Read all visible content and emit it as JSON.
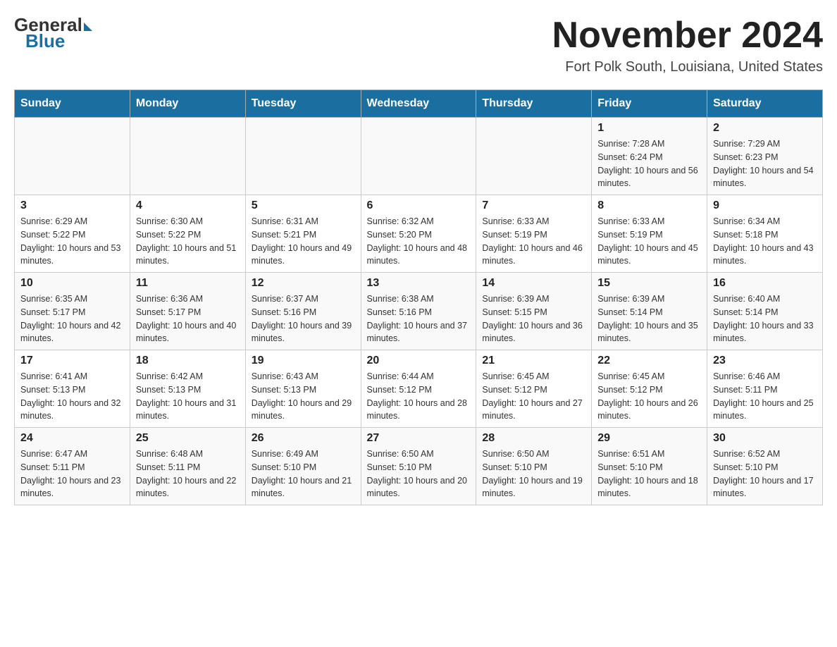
{
  "logo": {
    "general": "General",
    "blue": "Blue"
  },
  "title": "November 2024",
  "location": "Fort Polk South, Louisiana, United States",
  "days_of_week": [
    "Sunday",
    "Monday",
    "Tuesday",
    "Wednesday",
    "Thursday",
    "Friday",
    "Saturday"
  ],
  "weeks": [
    {
      "days": [
        {
          "number": "",
          "info": ""
        },
        {
          "number": "",
          "info": ""
        },
        {
          "number": "",
          "info": ""
        },
        {
          "number": "",
          "info": ""
        },
        {
          "number": "",
          "info": ""
        },
        {
          "number": "1",
          "info": "Sunrise: 7:28 AM\nSunset: 6:24 PM\nDaylight: 10 hours and 56 minutes."
        },
        {
          "number": "2",
          "info": "Sunrise: 7:29 AM\nSunset: 6:23 PM\nDaylight: 10 hours and 54 minutes."
        }
      ]
    },
    {
      "days": [
        {
          "number": "3",
          "info": "Sunrise: 6:29 AM\nSunset: 5:22 PM\nDaylight: 10 hours and 53 minutes."
        },
        {
          "number": "4",
          "info": "Sunrise: 6:30 AM\nSunset: 5:22 PM\nDaylight: 10 hours and 51 minutes."
        },
        {
          "number": "5",
          "info": "Sunrise: 6:31 AM\nSunset: 5:21 PM\nDaylight: 10 hours and 49 minutes."
        },
        {
          "number": "6",
          "info": "Sunrise: 6:32 AM\nSunset: 5:20 PM\nDaylight: 10 hours and 48 minutes."
        },
        {
          "number": "7",
          "info": "Sunrise: 6:33 AM\nSunset: 5:19 PM\nDaylight: 10 hours and 46 minutes."
        },
        {
          "number": "8",
          "info": "Sunrise: 6:33 AM\nSunset: 5:19 PM\nDaylight: 10 hours and 45 minutes."
        },
        {
          "number": "9",
          "info": "Sunrise: 6:34 AM\nSunset: 5:18 PM\nDaylight: 10 hours and 43 minutes."
        }
      ]
    },
    {
      "days": [
        {
          "number": "10",
          "info": "Sunrise: 6:35 AM\nSunset: 5:17 PM\nDaylight: 10 hours and 42 minutes."
        },
        {
          "number": "11",
          "info": "Sunrise: 6:36 AM\nSunset: 5:17 PM\nDaylight: 10 hours and 40 minutes."
        },
        {
          "number": "12",
          "info": "Sunrise: 6:37 AM\nSunset: 5:16 PM\nDaylight: 10 hours and 39 minutes."
        },
        {
          "number": "13",
          "info": "Sunrise: 6:38 AM\nSunset: 5:16 PM\nDaylight: 10 hours and 37 minutes."
        },
        {
          "number": "14",
          "info": "Sunrise: 6:39 AM\nSunset: 5:15 PM\nDaylight: 10 hours and 36 minutes."
        },
        {
          "number": "15",
          "info": "Sunrise: 6:39 AM\nSunset: 5:14 PM\nDaylight: 10 hours and 35 minutes."
        },
        {
          "number": "16",
          "info": "Sunrise: 6:40 AM\nSunset: 5:14 PM\nDaylight: 10 hours and 33 minutes."
        }
      ]
    },
    {
      "days": [
        {
          "number": "17",
          "info": "Sunrise: 6:41 AM\nSunset: 5:13 PM\nDaylight: 10 hours and 32 minutes."
        },
        {
          "number": "18",
          "info": "Sunrise: 6:42 AM\nSunset: 5:13 PM\nDaylight: 10 hours and 31 minutes."
        },
        {
          "number": "19",
          "info": "Sunrise: 6:43 AM\nSunset: 5:13 PM\nDaylight: 10 hours and 29 minutes."
        },
        {
          "number": "20",
          "info": "Sunrise: 6:44 AM\nSunset: 5:12 PM\nDaylight: 10 hours and 28 minutes."
        },
        {
          "number": "21",
          "info": "Sunrise: 6:45 AM\nSunset: 5:12 PM\nDaylight: 10 hours and 27 minutes."
        },
        {
          "number": "22",
          "info": "Sunrise: 6:45 AM\nSunset: 5:12 PM\nDaylight: 10 hours and 26 minutes."
        },
        {
          "number": "23",
          "info": "Sunrise: 6:46 AM\nSunset: 5:11 PM\nDaylight: 10 hours and 25 minutes."
        }
      ]
    },
    {
      "days": [
        {
          "number": "24",
          "info": "Sunrise: 6:47 AM\nSunset: 5:11 PM\nDaylight: 10 hours and 23 minutes."
        },
        {
          "number": "25",
          "info": "Sunrise: 6:48 AM\nSunset: 5:11 PM\nDaylight: 10 hours and 22 minutes."
        },
        {
          "number": "26",
          "info": "Sunrise: 6:49 AM\nSunset: 5:10 PM\nDaylight: 10 hours and 21 minutes."
        },
        {
          "number": "27",
          "info": "Sunrise: 6:50 AM\nSunset: 5:10 PM\nDaylight: 10 hours and 20 minutes."
        },
        {
          "number": "28",
          "info": "Sunrise: 6:50 AM\nSunset: 5:10 PM\nDaylight: 10 hours and 19 minutes."
        },
        {
          "number": "29",
          "info": "Sunrise: 6:51 AM\nSunset: 5:10 PM\nDaylight: 10 hours and 18 minutes."
        },
        {
          "number": "30",
          "info": "Sunrise: 6:52 AM\nSunset: 5:10 PM\nDaylight: 10 hours and 17 minutes."
        }
      ]
    }
  ]
}
